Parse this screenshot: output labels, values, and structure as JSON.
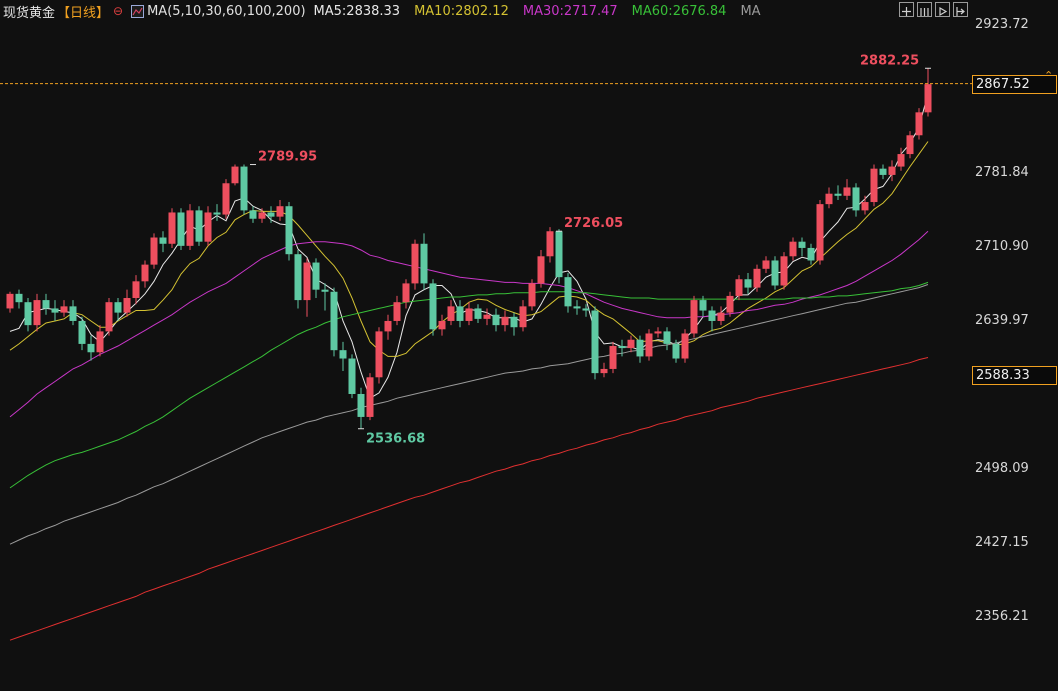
{
  "header": {
    "title": "现货黄金",
    "period": "【日线】",
    "toggle": "⊖",
    "ma_label": "MA(5,10,30,60,100,200)",
    "ma5": "MA5:2838.33",
    "ma10": "MA10:2802.12",
    "ma30": "MA30:2717.47",
    "ma60": "MA60:2676.84",
    "ma_more": "MA"
  },
  "toolbar": {
    "icons": [
      "crosshair-icon",
      "candle-layout-icon",
      "play-icon",
      "exit-icon"
    ]
  },
  "colors": {
    "background": "#101010",
    "up": "#ee4f5f",
    "down": "#5fc9a3",
    "ma5": "#e8e8e8",
    "ma10": "#d4c232",
    "ma30": "#c837c8",
    "ma60": "#38c038",
    "ma100": "#9a9a9a",
    "ma200": "#e03030",
    "current_price_line": "#f0a020"
  },
  "chart_data": {
    "type": "candlestick",
    "title": "现货黄金",
    "period": "日线",
    "y_ticks": [
      "2923.72",
      "2867.52",
      "2781.84",
      "2710.90",
      "2639.97",
      "2588.33",
      "2498.09",
      "2427.15",
      "2356.21"
    ],
    "current_price": 2867.52,
    "previous_close_level": 2588.33,
    "annotations": [
      {
        "label": "2789.95",
        "type": "local_high"
      },
      {
        "label": "2726.05",
        "type": "local_high"
      },
      {
        "label": "2536.68",
        "type": "local_low"
      },
      {
        "label": "2882.25",
        "type": "recent_high"
      }
    ],
    "candles": [
      [
        2652,
        2666,
        2668,
        2648
      ],
      [
        2666,
        2658,
        2670,
        2652
      ],
      [
        2658,
        2636,
        2662,
        2630
      ],
      [
        2636,
        2660,
        2666,
        2630
      ],
      [
        2660,
        2652,
        2666,
        2646
      ],
      [
        2652,
        2648,
        2660,
        2640
      ],
      [
        2648,
        2654,
        2660,
        2644
      ],
      [
        2654,
        2640,
        2660,
        2636
      ],
      [
        2640,
        2618,
        2644,
        2612
      ],
      [
        2618,
        2610,
        2626,
        2602
      ],
      [
        2610,
        2630,
        2636,
        2606
      ],
      [
        2630,
        2658,
        2662,
        2626
      ],
      [
        2658,
        2648,
        2662,
        2640
      ],
      [
        2648,
        2662,
        2670,
        2644
      ],
      [
        2662,
        2678,
        2684,
        2656
      ],
      [
        2678,
        2694,
        2698,
        2672
      ],
      [
        2694,
        2720,
        2724,
        2690
      ],
      [
        2720,
        2714,
        2726,
        2706
      ],
      [
        2714,
        2744,
        2748,
        2710
      ],
      [
        2744,
        2712,
        2748,
        2708
      ],
      [
        2712,
        2746,
        2752,
        2708
      ],
      [
        2746,
        2716,
        2750,
        2712
      ],
      [
        2716,
        2744,
        2750,
        2712
      ],
      [
        2744,
        2742,
        2752,
        2736
      ],
      [
        2742,
        2772,
        2776,
        2738
      ],
      [
        2772,
        2788,
        2790,
        2770
      ],
      [
        2788,
        2746,
        2790,
        2742
      ],
      [
        2746,
        2738,
        2750,
        2734
      ],
      [
        2738,
        2744,
        2748,
        2734
      ],
      [
        2744,
        2740,
        2750,
        2734
      ],
      [
        2740,
        2750,
        2756,
        2736
      ],
      [
        2750,
        2704,
        2754,
        2698
      ],
      [
        2704,
        2660,
        2708,
        2652
      ],
      [
        2660,
        2696,
        2700,
        2644
      ],
      [
        2696,
        2670,
        2700,
        2662
      ],
      [
        2670,
        2668,
        2676,
        2650
      ],
      [
        2668,
        2612,
        2672,
        2606
      ],
      [
        2612,
        2604,
        2620,
        2592
      ],
      [
        2604,
        2570,
        2608,
        2566
      ],
      [
        2570,
        2548,
        2576,
        2537
      ],
      [
        2548,
        2586,
        2590,
        2545
      ],
      [
        2586,
        2630,
        2634,
        2580
      ],
      [
        2630,
        2640,
        2646,
        2622
      ],
      [
        2640,
        2658,
        2664,
        2636
      ],
      [
        2658,
        2676,
        2680,
        2652
      ],
      [
        2676,
        2714,
        2718,
        2670
      ],
      [
        2714,
        2676,
        2724,
        2670
      ],
      [
        2676,
        2632,
        2680,
        2626
      ],
      [
        2632,
        2640,
        2646,
        2626
      ],
      [
        2640,
        2654,
        2660,
        2636
      ],
      [
        2654,
        2640,
        2660,
        2634
      ],
      [
        2640,
        2652,
        2658,
        2636
      ],
      [
        2652,
        2642,
        2656,
        2638
      ],
      [
        2642,
        2646,
        2652,
        2636
      ],
      [
        2646,
        2636,
        2652,
        2630
      ],
      [
        2636,
        2644,
        2650,
        2630
      ],
      [
        2644,
        2634,
        2648,
        2626
      ],
      [
        2634,
        2654,
        2660,
        2630
      ],
      [
        2654,
        2676,
        2680,
        2650
      ],
      [
        2676,
        2702,
        2708,
        2672
      ],
      [
        2702,
        2726,
        2730,
        2696
      ],
      [
        2726,
        2682,
        2728,
        2676
      ],
      [
        2682,
        2654,
        2686,
        2648
      ],
      [
        2654,
        2652,
        2660,
        2646
      ],
      [
        2652,
        2650,
        2656,
        2644
      ],
      [
        2650,
        2590,
        2654,
        2584
      ],
      [
        2590,
        2594,
        2600,
        2586
      ],
      [
        2594,
        2616,
        2620,
        2590
      ],
      [
        2616,
        2614,
        2622,
        2606
      ],
      [
        2614,
        2622,
        2626,
        2610
      ],
      [
        2622,
        2606,
        2626,
        2600
      ],
      [
        2606,
        2628,
        2632,
        2602
      ],
      [
        2628,
        2630,
        2634,
        2624
      ],
      [
        2630,
        2618,
        2634,
        2612
      ],
      [
        2618,
        2604,
        2622,
        2600
      ],
      [
        2604,
        2628,
        2632,
        2600
      ],
      [
        2628,
        2660,
        2664,
        2624
      ],
      [
        2660,
        2650,
        2664,
        2644
      ],
      [
        2650,
        2640,
        2654,
        2630
      ],
      [
        2640,
        2648,
        2654,
        2636
      ],
      [
        2648,
        2664,
        2668,
        2644
      ],
      [
        2664,
        2680,
        2684,
        2660
      ],
      [
        2680,
        2672,
        2686,
        2666
      ],
      [
        2672,
        2690,
        2694,
        2668
      ],
      [
        2690,
        2698,
        2702,
        2686
      ],
      [
        2698,
        2674,
        2702,
        2670
      ],
      [
        2674,
        2702,
        2706,
        2670
      ],
      [
        2702,
        2716,
        2720,
        2698
      ],
      [
        2716,
        2710,
        2720,
        2702
      ],
      [
        2710,
        2698,
        2714,
        2694
      ],
      [
        2698,
        2752,
        2756,
        2694
      ],
      [
        2752,
        2762,
        2768,
        2748
      ],
      [
        2762,
        2760,
        2770,
        2756
      ],
      [
        2760,
        2768,
        2776,
        2756
      ],
      [
        2768,
        2746,
        2772,
        2740
      ],
      [
        2746,
        2754,
        2760,
        2742
      ],
      [
        2754,
        2786,
        2790,
        2750
      ],
      [
        2786,
        2780,
        2790,
        2776
      ],
      [
        2780,
        2788,
        2794,
        2774
      ],
      [
        2788,
        2800,
        2806,
        2784
      ],
      [
        2800,
        2818,
        2822,
        2796
      ],
      [
        2818,
        2840,
        2844,
        2814
      ],
      [
        2840,
        2867,
        2882,
        2836
      ]
    ],
    "ma_series": [
      {
        "name": "MA5",
        "values": [
          2630,
          2633,
          2648,
          2650,
          2652,
          2651,
          2649,
          2648,
          2642,
          2627,
          2620,
          2630,
          2641,
          2649,
          2657,
          2666,
          2678,
          2694,
          2705,
          2718,
          2731,
          2727,
          2735,
          2741,
          2736,
          2755,
          2758,
          2750,
          2746,
          2737,
          2733,
          2732,
          2709,
          2701,
          2680,
          2675,
          2669,
          2640,
          2620,
          2591,
          2566,
          2571,
          2586,
          2610,
          2645,
          2665,
          2670,
          2674,
          2674,
          2666,
          2647,
          2651,
          2650,
          2648,
          2643,
          2643,
          2643,
          2639,
          2642,
          2656,
          2672,
          2686,
          2688,
          2678,
          2661,
          2629,
          2618,
          2619,
          2615,
          2615,
          2612,
          2620,
          2622,
          2621,
          2617,
          2623,
          2632,
          2644,
          2645,
          2648,
          2656,
          2665,
          2665,
          2673,
          2682,
          2686,
          2687,
          2697,
          2701,
          2699,
          2716,
          2726,
          2735,
          2748,
          2749,
          2757,
          2766,
          2769,
          2781,
          2800,
          2810,
          2826,
          2858
        ]
      },
      {
        "name": "MA10",
        "values": [
          2612,
          2618,
          2625,
          2632,
          2638,
          2640,
          2642,
          2648,
          2646,
          2640,
          2634,
          2634,
          2640,
          2645,
          2650,
          2650,
          2651,
          2660,
          2670,
          2685,
          2695,
          2700,
          2712,
          2720,
          2725,
          2737,
          2742,
          2746,
          2745,
          2745,
          2745,
          2741,
          2732,
          2722,
          2712,
          2702,
          2693,
          2681,
          2662,
          2640,
          2620,
          2612,
          2606,
          2606,
          2609,
          2618,
          2624,
          2630,
          2639,
          2646,
          2651,
          2658,
          2661,
          2660,
          2655,
          2651,
          2648,
          2645,
          2646,
          2649,
          2656,
          2663,
          2664,
          2663,
          2660,
          2652,
          2646,
          2642,
          2635,
          2628,
          2620,
          2621,
          2621,
          2619,
          2617,
          2618,
          2621,
          2627,
          2631,
          2633,
          2638,
          2645,
          2652,
          2657,
          2662,
          2668,
          2672,
          2680,
          2688,
          2692,
          2700,
          2708,
          2716,
          2723,
          2729,
          2738,
          2747,
          2753,
          2762,
          2775,
          2788,
          2800,
          2812
        ]
      },
      {
        "name": "MA30",
        "values": [
          2548,
          2555,
          2562,
          2570,
          2576,
          2582,
          2588,
          2594,
          2598,
          2603,
          2608,
          2612,
          2616,
          2621,
          2626,
          2631,
          2636,
          2641,
          2646,
          2652,
          2658,
          2663,
          2668,
          2672,
          2676,
          2682,
          2688,
          2694,
          2700,
          2704,
          2708,
          2712,
          2714,
          2715,
          2716,
          2716,
          2715,
          2714,
          2712,
          2708,
          2703,
          2701,
          2698,
          2696,
          2694,
          2692,
          2690,
          2688,
          2686,
          2684,
          2682,
          2681,
          2680,
          2679,
          2678,
          2677,
          2677,
          2676,
          2676,
          2676,
          2675,
          2674,
          2672,
          2669,
          2666,
          2662,
          2658,
          2655,
          2652,
          2650,
          2648,
          2646,
          2644,
          2643,
          2643,
          2643,
          2644,
          2644,
          2645,
          2646,
          2647,
          2648,
          2650,
          2651,
          2653,
          2655,
          2656,
          2658,
          2661,
          2663,
          2665,
          2668,
          2671,
          2674,
          2678,
          2683,
          2688,
          2693,
          2698,
          2704,
          2711,
          2718,
          2726
        ]
      },
      {
        "name": "MA60",
        "values": [
          2480,
          2486,
          2492,
          2497,
          2502,
          2506,
          2509,
          2512,
          2514,
          2517,
          2520,
          2523,
          2526,
          2530,
          2534,
          2539,
          2543,
          2548,
          2554,
          2560,
          2566,
          2571,
          2576,
          2581,
          2586,
          2591,
          2596,
          2601,
          2606,
          2612,
          2617,
          2622,
          2627,
          2631,
          2634,
          2638,
          2641,
          2644,
          2646,
          2648,
          2650,
          2652,
          2654,
          2656,
          2658,
          2659,
          2660,
          2661,
          2662,
          2663,
          2663,
          2664,
          2665,
          2665,
          2666,
          2666,
          2667,
          2667,
          2667,
          2668,
          2668,
          2668,
          2668,
          2667,
          2667,
          2666,
          2665,
          2664,
          2663,
          2662,
          2662,
          2662,
          2661,
          2661,
          2661,
          2661,
          2661,
          2661,
          2661,
          2661,
          2661,
          2661,
          2661,
          2661,
          2661,
          2661,
          2661,
          2662,
          2662,
          2662,
          2663,
          2663,
          2664,
          2664,
          2665,
          2666,
          2667,
          2668,
          2669,
          2671,
          2672,
          2674,
          2677
        ]
      },
      {
        "name": "MA100",
        "values": [
          2426,
          2430,
          2434,
          2437,
          2441,
          2444,
          2448,
          2451,
          2454,
          2457,
          2460,
          2463,
          2466,
          2470,
          2473,
          2477,
          2481,
          2484,
          2488,
          2492,
          2496,
          2500,
          2504,
          2508,
          2512,
          2516,
          2520,
          2524,
          2528,
          2531,
          2534,
          2537,
          2540,
          2543,
          2545,
          2548,
          2550,
          2552,
          2554,
          2557,
          2559,
          2561,
          2563,
          2566,
          2568,
          2570,
          2572,
          2574,
          2576,
          2578,
          2580,
          2582,
          2584,
          2586,
          2588,
          2590,
          2591,
          2592,
          2594,
          2595,
          2597,
          2598,
          2599,
          2601,
          2603,
          2605,
          2606,
          2608,
          2609,
          2611,
          2612,
          2614,
          2616,
          2617,
          2619,
          2621,
          2623,
          2625,
          2627,
          2629,
          2631,
          2633,
          2635,
          2637,
          2639,
          2641,
          2643,
          2645,
          2647,
          2649,
          2651,
          2653,
          2655,
          2657,
          2658,
          2660,
          2662,
          2664,
          2666,
          2668,
          2670,
          2672,
          2675
        ]
      },
      {
        "name": "MA200",
        "values": [
          2334,
          2337,
          2340,
          2343,
          2346,
          2349,
          2352,
          2355,
          2358,
          2361,
          2364,
          2367,
          2370,
          2373,
          2376,
          2380,
          2383,
          2386,
          2389,
          2392,
          2395,
          2398,
          2402,
          2405,
          2408,
          2411,
          2414,
          2417,
          2420,
          2423,
          2426,
          2429,
          2432,
          2435,
          2438,
          2441,
          2444,
          2447,
          2450,
          2453,
          2456,
          2459,
          2462,
          2465,
          2468,
          2471,
          2473,
          2476,
          2479,
          2482,
          2485,
          2487,
          2490,
          2493,
          2496,
          2498,
          2501,
          2503,
          2506,
          2508,
          2511,
          2513,
          2516,
          2518,
          2521,
          2523,
          2526,
          2528,
          2531,
          2533,
          2536,
          2538,
          2541,
          2543,
          2545,
          2548,
          2550,
          2552,
          2554,
          2557,
          2559,
          2561,
          2563,
          2566,
          2568,
          2570,
          2572,
          2574,
          2576,
          2578,
          2580,
          2582,
          2584,
          2586,
          2588,
          2590,
          2592,
          2594,
          2596,
          2598,
          2600,
          2603,
          2605
        ]
      }
    ]
  }
}
